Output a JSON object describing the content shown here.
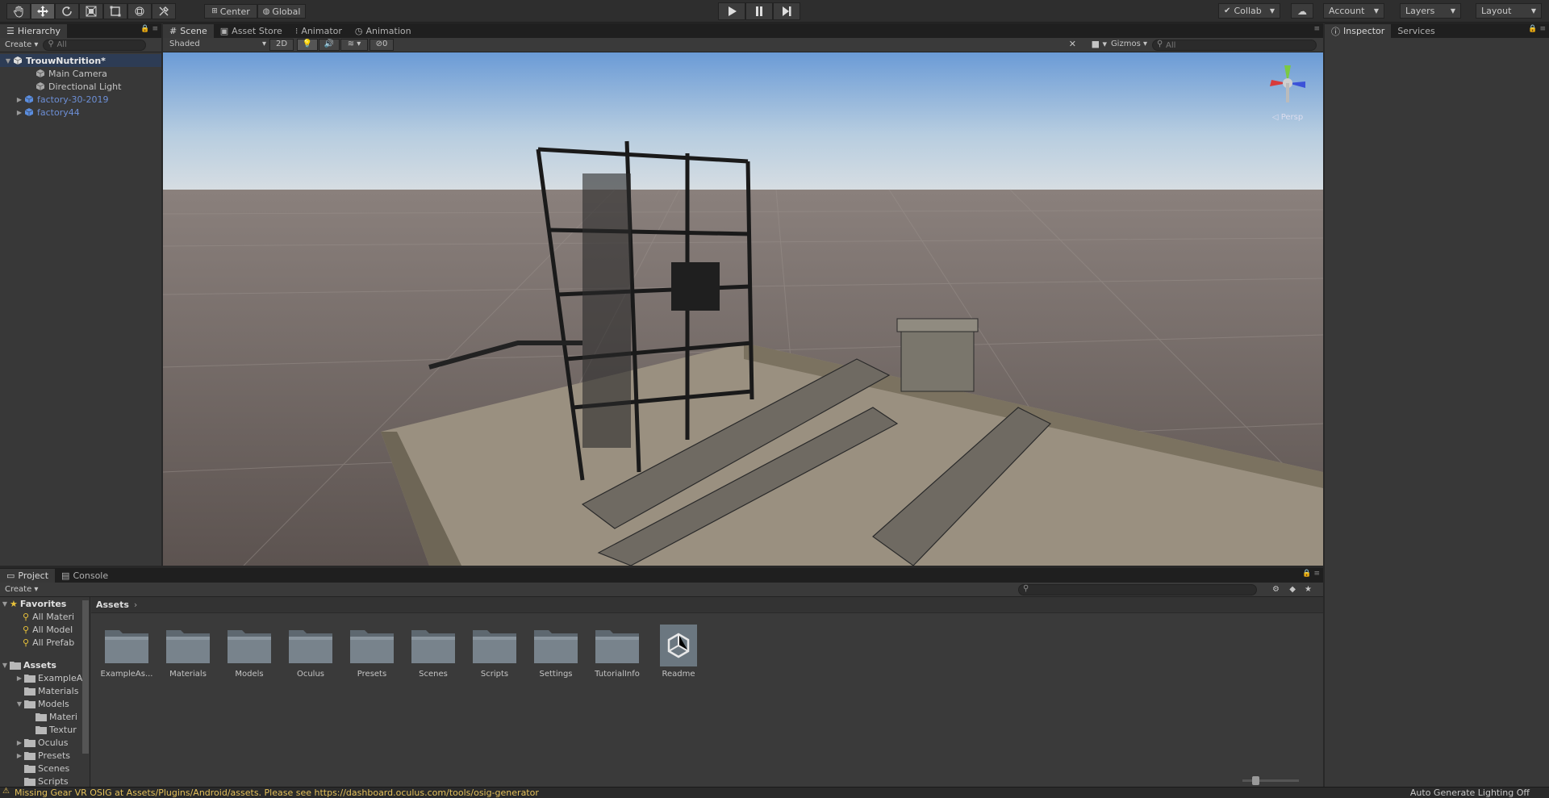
{
  "toolbar": {
    "tools": [
      "hand-icon",
      "move-icon",
      "rotate-icon",
      "scale-icon",
      "rect-icon",
      "transform-icon",
      "custom-tool-icon"
    ],
    "pivot_label": "Center",
    "space_label": "Global",
    "collab_label": "Collab",
    "account_label": "Account",
    "layers_label": "Layers",
    "layout_label": "Layout"
  },
  "hierarchy": {
    "tab_label": "Hierarchy",
    "create_label": "Create",
    "search_placeholder": "All",
    "items": [
      {
        "label": "TrouwNutrition*",
        "kind": "scene",
        "indent": 0
      },
      {
        "label": "Main Camera",
        "kind": "object",
        "indent": 2
      },
      {
        "label": "Directional Light",
        "kind": "object",
        "indent": 2
      },
      {
        "label": "factory-30-2019",
        "kind": "prefab",
        "indent": 1
      },
      {
        "label": "factory44",
        "kind": "prefab",
        "indent": 1
      }
    ]
  },
  "scene": {
    "tabs": [
      "Scene",
      "Asset Store",
      "Animator",
      "Animation"
    ],
    "shading_mode": "Shaded",
    "mode_2d": "2D",
    "hidden_count": "0",
    "gizmos_label": "Gizmos",
    "search_placeholder": "All",
    "persp_label": "Persp"
  },
  "inspector": {
    "tabs": [
      "Inspector",
      "Services"
    ]
  },
  "project": {
    "tabs": [
      "Project",
      "Console"
    ],
    "create_label": "Create",
    "favorites_label": "Favorites",
    "favorites": [
      "All Materi",
      "All Model",
      "All Prefab"
    ],
    "assets_label": "Assets",
    "tree": [
      {
        "label": "ExampleA",
        "indent": 1,
        "expanded": false
      },
      {
        "label": "Materials",
        "indent": 1,
        "expanded": null
      },
      {
        "label": "Models",
        "indent": 1,
        "expanded": true
      },
      {
        "label": "Materi",
        "indent": 2,
        "expanded": null
      },
      {
        "label": "Textur",
        "indent": 2,
        "expanded": null
      },
      {
        "label": "Oculus",
        "indent": 1,
        "expanded": false
      },
      {
        "label": "Presets",
        "indent": 1,
        "expanded": false
      },
      {
        "label": "Scenes",
        "indent": 1,
        "expanded": null
      },
      {
        "label": "Scripts",
        "indent": 1,
        "expanded": null
      }
    ],
    "breadcrumb": "Assets",
    "grid_items": [
      {
        "label": "ExampleAs...",
        "type": "folder"
      },
      {
        "label": "Materials",
        "type": "folder"
      },
      {
        "label": "Models",
        "type": "folder"
      },
      {
        "label": "Oculus",
        "type": "folder"
      },
      {
        "label": "Presets",
        "type": "folder"
      },
      {
        "label": "Scenes",
        "type": "folder"
      },
      {
        "label": "Scripts",
        "type": "folder"
      },
      {
        "label": "Settings",
        "type": "folder"
      },
      {
        "label": "TutorialInfo",
        "type": "folder"
      },
      {
        "label": "Readme",
        "type": "unity-asset"
      }
    ]
  },
  "status": {
    "message": "Missing Gear VR OSIG at Assets/Plugins/Android/assets. Please see https://dashboard.oculus.com/tools/osig-generator",
    "lighting": "Auto Generate Lighting Off"
  },
  "colors": {
    "warning": "#e4c05a",
    "prefab": "#6d8fd6",
    "selection": "#2d3c55"
  }
}
